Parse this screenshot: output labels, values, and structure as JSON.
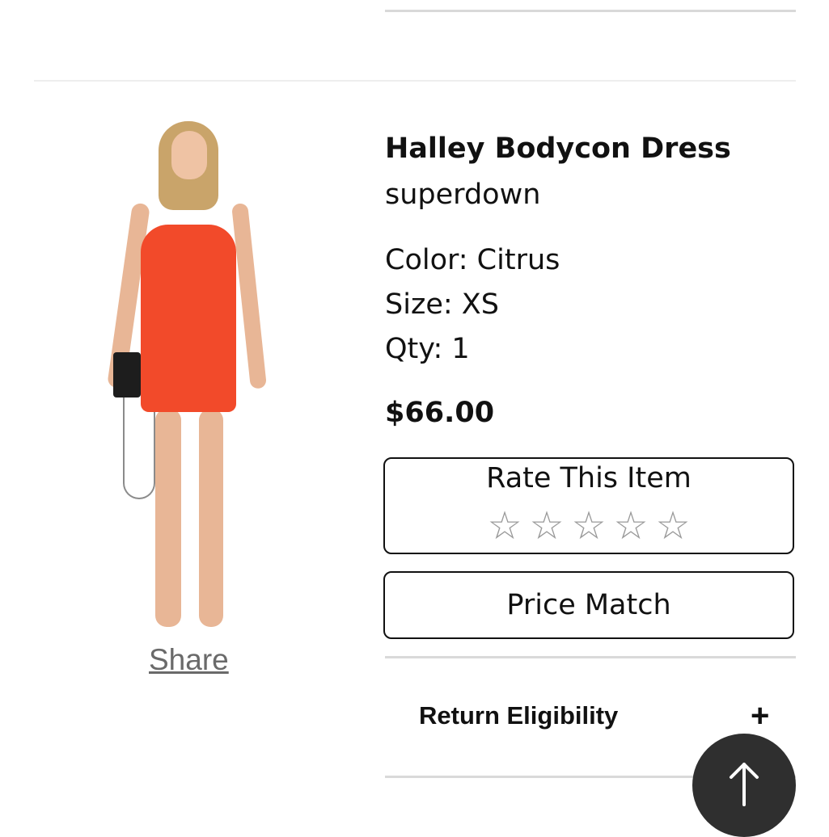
{
  "product": {
    "title": "Halley Bodycon Dress",
    "brand": "superdown",
    "color_label": "Color: Citrus",
    "size_label": "Size: XS",
    "qty_label": "Qty: 1",
    "price": "$66.00",
    "dress_color": "#f24a2a"
  },
  "share": {
    "label": "Share"
  },
  "rating": {
    "title": "Rate This Item",
    "stars": [
      "☆",
      "☆",
      "☆",
      "☆",
      "☆"
    ],
    "value": 0,
    "max": 5
  },
  "price_match": {
    "label": "Price Match"
  },
  "return_eligibility": {
    "label": "Return Eligibility",
    "toggle": "+"
  },
  "icons": {
    "expand": "plus-icon",
    "scroll_top": "arrow-up-icon"
  }
}
